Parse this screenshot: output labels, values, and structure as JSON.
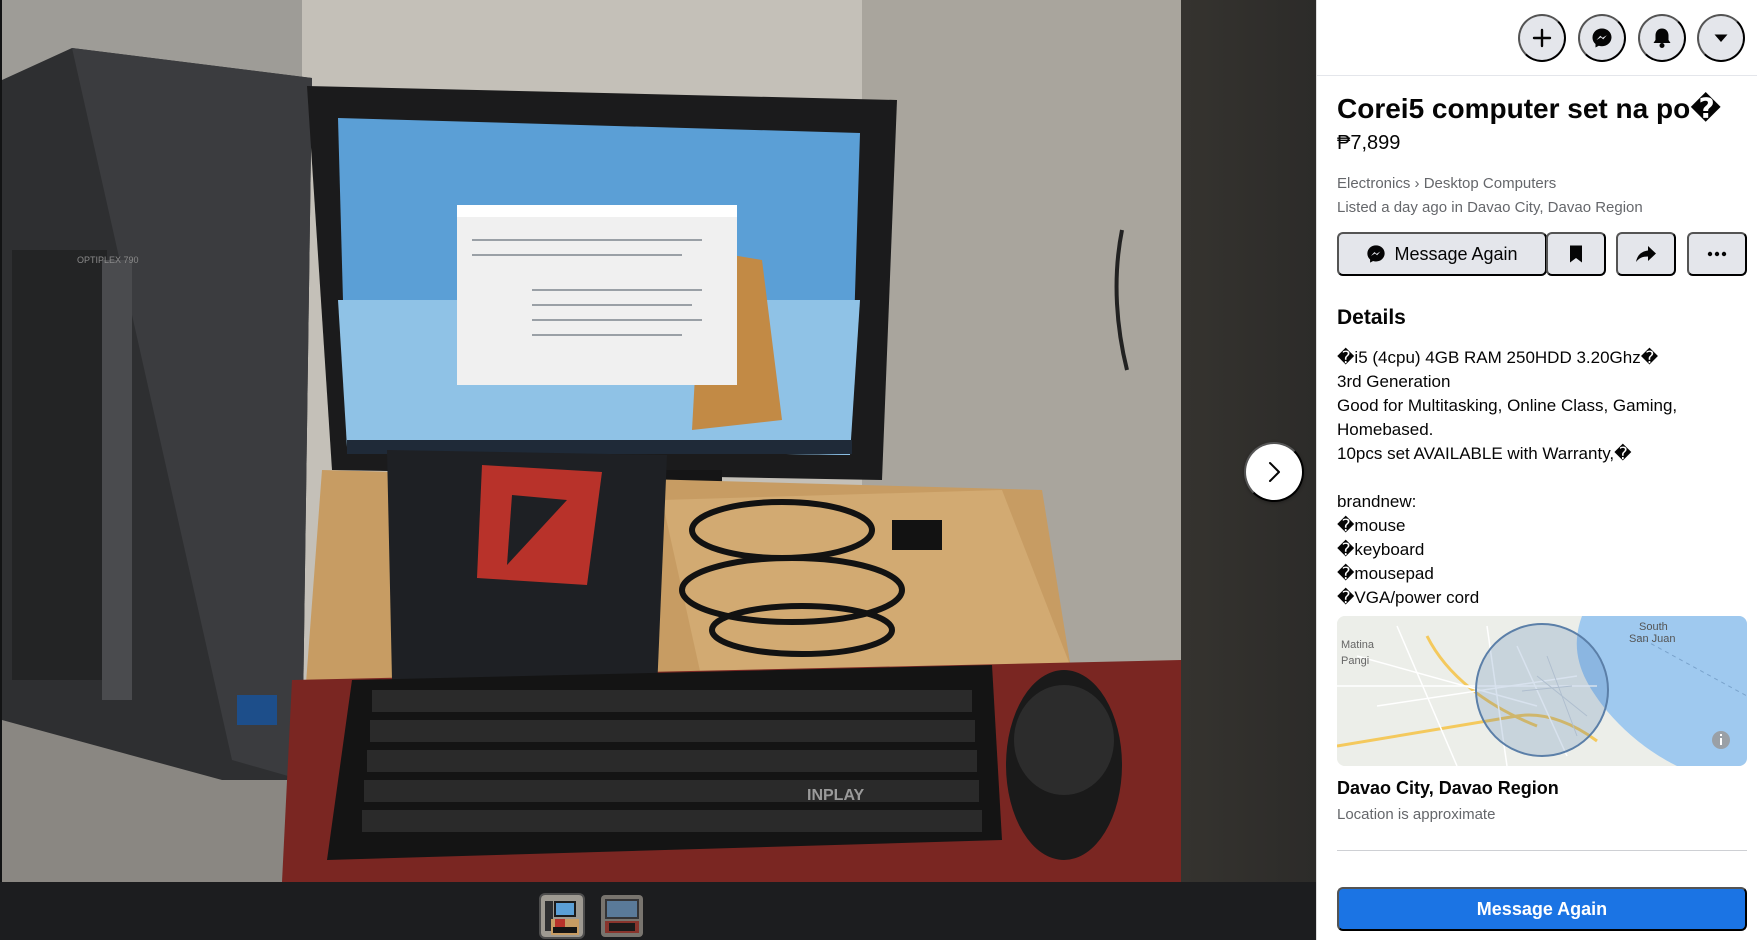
{
  "viewer": {
    "photo_alt": "Desktop computer set",
    "keyboard_brand": "INPLAY",
    "tower_model": "OPTIPLEX 790",
    "thumbnails": [
      {
        "label": "photo-1",
        "selected": true
      },
      {
        "label": "photo-2",
        "selected": false
      }
    ]
  },
  "topbar": {
    "create_icon": "plus-icon",
    "messenger_icon": "messenger-icon",
    "notifications_icon": "bell-icon",
    "account_icon": "caret-down-icon"
  },
  "listing": {
    "title": "Corei5 computer set na po�",
    "price": "₱7,899",
    "category_parent": "Electronics",
    "category_separator": "›",
    "category_child": "Desktop Computers",
    "listed": "Listed a day ago in Davao City, Davao Region"
  },
  "actions": {
    "message_again": "Message Again"
  },
  "details": {
    "heading": "Details",
    "description": "�i5 (4cpu) 4GB RAM 250HDD 3.20Ghz�\n3rd Generation\nGood for Multitasking, Online Class, Gaming, Homebased.\n10pcs set AVAILABLE with Warranty,�\n\nbrandnew:\n�mouse\n�keyboard\n�mousepad\n�VGA/power cord"
  },
  "map": {
    "labels": [
      "South",
      "San Juan",
      "Matina",
      "Pangi"
    ]
  },
  "location": {
    "name": "Davao City, Davao Region",
    "note": "Location is approximate"
  },
  "bottom": {
    "message_again": "Message Again"
  },
  "colors": {
    "accent": "#1b74e4",
    "secondary_text": "#65676b",
    "button_bg": "#e4e6eb"
  }
}
